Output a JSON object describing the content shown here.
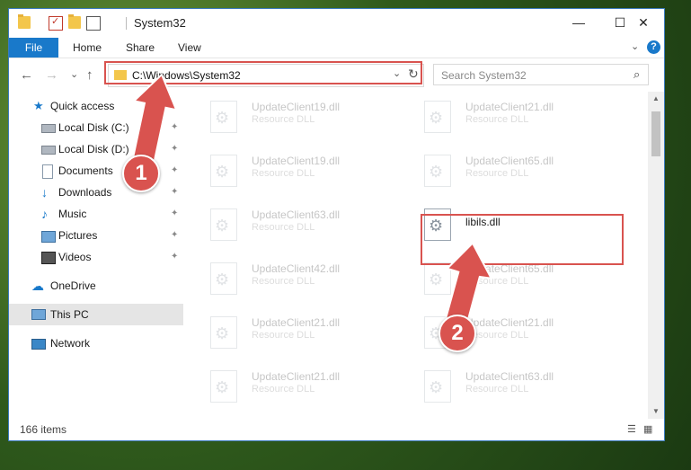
{
  "window": {
    "title": "System32",
    "controls": {
      "minimize": "—",
      "maximize": "☐",
      "close": "✕"
    }
  },
  "ribbon": {
    "file": "File",
    "tabs": [
      "Home",
      "Share",
      "View"
    ]
  },
  "navigation": {
    "back": "←",
    "forward": "→",
    "recent": "⌄",
    "up": "↑",
    "address": "C:\\Windows\\System32",
    "refresh": "↻",
    "search_placeholder": "Search System32",
    "search_icon": "⌕"
  },
  "sidebar": {
    "items": [
      {
        "label": "Quick access",
        "icon": "star-icon",
        "glyph": "★"
      },
      {
        "label": "Local Disk (C:)",
        "icon": "drive-icon",
        "glyph": "",
        "pinned": true
      },
      {
        "label": "Local Disk (D:)",
        "icon": "drive-icon",
        "glyph": "",
        "pinned": true
      },
      {
        "label": "Documents",
        "icon": "document-icon",
        "glyph": "",
        "pinned": true
      },
      {
        "label": "Downloads",
        "icon": "download-icon",
        "glyph": "↓",
        "pinned": true
      },
      {
        "label": "Music",
        "icon": "music-icon",
        "glyph": "♪",
        "pinned": true
      },
      {
        "label": "Pictures",
        "icon": "pictures-icon",
        "glyph": "",
        "pinned": true
      },
      {
        "label": "Videos",
        "icon": "videos-icon",
        "glyph": "",
        "pinned": true
      },
      {
        "label": "OneDrive",
        "icon": "cloud-icon",
        "glyph": "☁"
      },
      {
        "label": "This PC",
        "icon": "computer-icon",
        "glyph": ""
      },
      {
        "label": "Network",
        "icon": "network-icon",
        "glyph": ""
      }
    ],
    "pin_glyph": "📌"
  },
  "files": [
    {
      "name": "UpdateClient19.dll",
      "type": "Resource DLL"
    },
    {
      "name": "UpdateClient21.dll",
      "type": "Resource DLL"
    },
    {
      "name": "UpdateClient19.dll",
      "type": "Resource DLL"
    },
    {
      "name": "UpdateClient65.dll",
      "type": "Resource DLL"
    },
    {
      "name": "UpdateClient63.dll",
      "type": "Resource DLL"
    },
    {
      "name": "libils.dll",
      "type": ""
    },
    {
      "name": "UpdateClient42.dll",
      "type": "Resource DLL"
    },
    {
      "name": "UpdateClient65.dll",
      "type": "Resource DLL"
    },
    {
      "name": "UpdateClient21.dll",
      "type": "Resource DLL"
    },
    {
      "name": "UpdateClient21.dll",
      "type": "Resource DLL"
    },
    {
      "name": "UpdateClient21.dll",
      "type": "Resource DLL"
    },
    {
      "name": "UpdateClient63.dll",
      "type": "Resource DLL"
    }
  ],
  "status": {
    "count": "166 items",
    "details_view": "☰",
    "tiles_view": "▦"
  },
  "annotations": {
    "step1": "1",
    "step2": "2",
    "color": "#d9534f"
  },
  "scroll": {
    "up": "▲",
    "down": "▼"
  }
}
